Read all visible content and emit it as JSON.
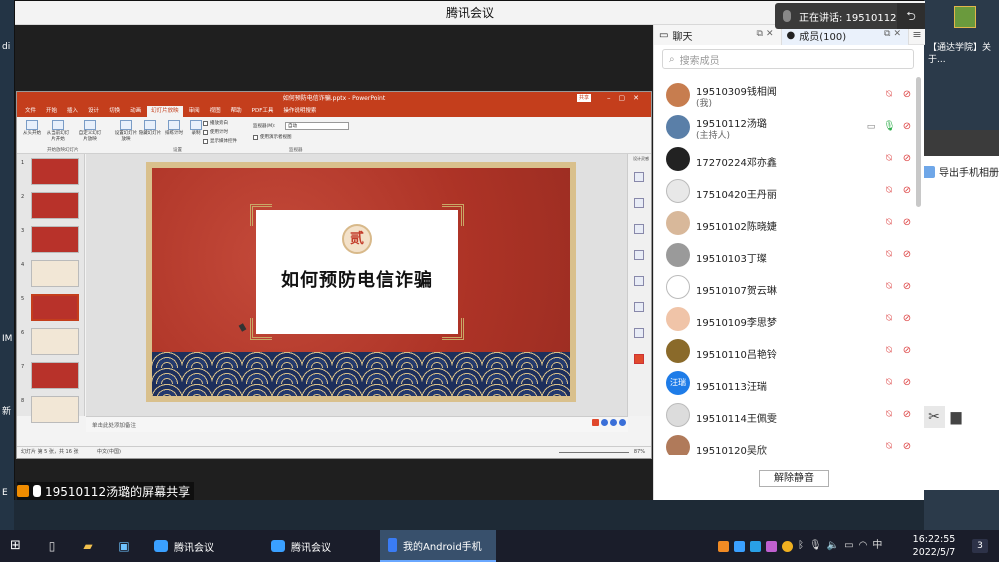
{
  "window_title": "腾讯会议",
  "speaking": {
    "label": "正在讲话: 19510112汤璐"
  },
  "share_label": "19510112汤璐的屏幕共享",
  "desktop": {
    "left_texts": [
      "di",
      "IM",
      "新",
      "E"
    ],
    "right_icon_label": "【通达学院】关于...",
    "export_label": "导出手机相册"
  },
  "ppt": {
    "filename": "如何预防电信诈骗.pptx - PowerPoint",
    "tabs": [
      "文件",
      "开始",
      "插入",
      "设计",
      "切换",
      "动画",
      "幻灯片放映",
      "审阅",
      "视图",
      "帮助",
      "PDF工具",
      "操作说明搜索"
    ],
    "active_tab_index": 6,
    "share_btn": "共享",
    "ribbon_buttons": [
      "从头开始",
      "从当前幻灯片开始",
      "自定义幻灯片放映",
      "设置幻灯片放映",
      "隐藏幻灯片",
      "排练计时",
      "录制"
    ],
    "ribbon_groups": [
      "开始放映幻灯片",
      "设置",
      "监视器"
    ],
    "checkboxes": [
      "播放旁白",
      "使用计时",
      "显示媒体控件",
      "使用演示者视图"
    ],
    "monitor_label": "监视器(M):",
    "monitor_value": "自动",
    "slide_numbers": [
      "1",
      "2",
      "3",
      "4",
      "5",
      "6",
      "7",
      "8"
    ],
    "selected_slide": 5,
    "slide_badge": "贰",
    "slide_title": "如何预防电信诈骗",
    "notes_placeholder": "单击此处添加备注",
    "status_left": "幻灯片 第 5 张，共 16 张",
    "status_lang": "中文(中国)",
    "status_zoom": "87%",
    "right_pane_label": "设计灵感"
  },
  "side": {
    "chat_tab": "聊天",
    "members_tab": "成员(100)",
    "search_placeholder": "搜索成员",
    "unmute_button": "解除静音",
    "members": [
      {
        "name": "19510309钱相闻",
        "sub": "(我)",
        "avatar": "",
        "avatar_color": "#c77d4f",
        "mic_on": false,
        "screen": false
      },
      {
        "name": "19510112汤璐",
        "sub": "(主持人)",
        "avatar": "",
        "avatar_color": "#5a7fa8",
        "mic_on": true,
        "screen": true
      },
      {
        "name": "17270224邓亦鑫",
        "sub": "",
        "avatar": "",
        "avatar_color": "#222222",
        "mic_on": false,
        "screen": false
      },
      {
        "name": "17510420王丹丽",
        "sub": "",
        "avatar": "",
        "avatar_color": "#e8e8e8",
        "mic_on": false,
        "screen": false
      },
      {
        "name": "19510102陈晓婕",
        "sub": "",
        "avatar": "",
        "avatar_color": "#d8b89a",
        "mic_on": false,
        "screen": false
      },
      {
        "name": "19510103丁璨",
        "sub": "",
        "avatar": "",
        "avatar_color": "#9a9a9a",
        "mic_on": false,
        "screen": false
      },
      {
        "name": "19510107贺云琳",
        "sub": "",
        "avatar": "",
        "avatar_color": "#ffffff",
        "mic_on": false,
        "screen": false
      },
      {
        "name": "19510109李思梦",
        "sub": "",
        "avatar": "",
        "avatar_color": "#f0c4a8",
        "mic_on": false,
        "screen": false
      },
      {
        "name": "19510110吕艳铃",
        "sub": "",
        "avatar": "",
        "avatar_color": "#8a6a2a",
        "mic_on": false,
        "screen": false
      },
      {
        "name": "19510113汪瑞",
        "sub": "",
        "avatar": "汪瑞",
        "avatar_color": "#1e7ce8",
        "mic_on": false,
        "screen": false
      },
      {
        "name": "19510114王佩雯",
        "sub": "",
        "avatar": "",
        "avatar_color": "#dcdcdc",
        "mic_on": false,
        "screen": false
      },
      {
        "name": "19510120吴欣",
        "sub": "",
        "avatar": "",
        "avatar_color": "#b07a5a",
        "mic_on": false,
        "screen": false
      }
    ]
  },
  "taskbar": {
    "apps": [
      {
        "label": "腾讯会议",
        "active": false
      },
      {
        "label": "腾讯会议",
        "active": false
      },
      {
        "label": "我的Android手机",
        "active": true
      }
    ],
    "ime": "中",
    "time": "16:22:55",
    "date": "2022/5/7",
    "notifications": "3"
  }
}
